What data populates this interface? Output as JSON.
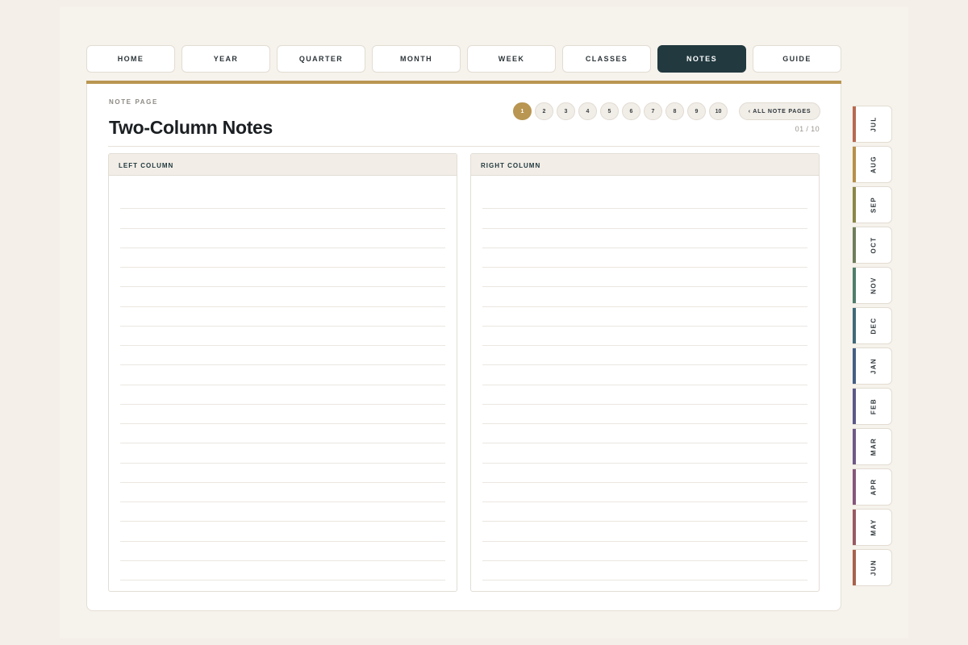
{
  "nav": [
    {
      "label": "HOME",
      "active": false
    },
    {
      "label": "YEAR",
      "active": false
    },
    {
      "label": "QUARTER",
      "active": false
    },
    {
      "label": "MONTH",
      "active": false
    },
    {
      "label": "WEEK",
      "active": false
    },
    {
      "label": "CLASSES",
      "active": false
    },
    {
      "label": "NOTES",
      "active": true
    },
    {
      "label": "GUIDE",
      "active": false
    }
  ],
  "header": {
    "eyebrow": "NOTE PAGE",
    "title": "Two-Column Notes",
    "counter": "01 / 10",
    "all_pages_label": "‹ ALL NOTE PAGES"
  },
  "pager": {
    "pages": [
      "1",
      "2",
      "3",
      "4",
      "5",
      "6",
      "7",
      "8",
      "9",
      "10"
    ],
    "current": "1"
  },
  "columns": {
    "left_title": "LEFT COLUMN",
    "right_title": "RIGHT COLUMN"
  },
  "accent": "#b99651",
  "active_nav_color": "#21393f",
  "month_tabs": [
    {
      "label": "JUL",
      "color": "#b76a50"
    },
    {
      "label": "AUG",
      "color": "#b8904a"
    },
    {
      "label": "SEP",
      "color": "#8a8748"
    },
    {
      "label": "OCT",
      "color": "#6f7e5b"
    },
    {
      "label": "NOV",
      "color": "#4f7d6c"
    },
    {
      "label": "DEC",
      "color": "#3f6978"
    },
    {
      "label": "JAN",
      "color": "#445e85"
    },
    {
      "label": "FEB",
      "color": "#5b5889"
    },
    {
      "label": "MAR",
      "color": "#6e5a86"
    },
    {
      "label": "APR",
      "color": "#86577a"
    },
    {
      "label": "MAY",
      "color": "#985a63"
    },
    {
      "label": "JUN",
      "color": "#a7624c"
    }
  ]
}
